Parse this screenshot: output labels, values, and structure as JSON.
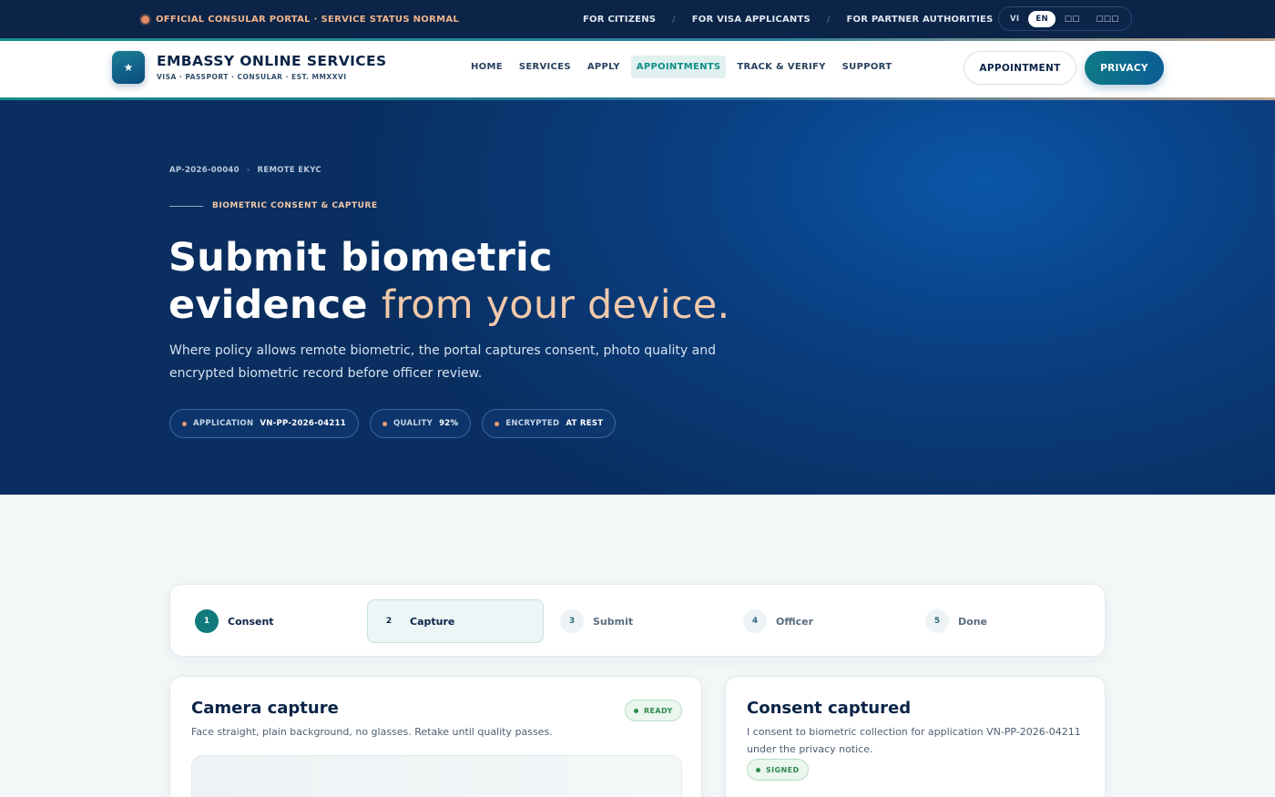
{
  "topbar": {
    "status": "OFFICIAL CONSULAR PORTAL · SERVICE STATUS NORMAL",
    "audiences": [
      "FOR CITIZENS",
      "FOR VISA APPLICANTS",
      "FOR PARTNER AUTHORITIES"
    ],
    "separator": "/",
    "languages": [
      "VI",
      "EN",
      "□□",
      "□□□"
    ],
    "active_language": "EN"
  },
  "header": {
    "logo_glyph": "★",
    "brand_title": "EMBASSY ONLINE SERVICES",
    "brand_subtitle": "VISA · PASSPORT · CONSULAR · EST. MMXXVI",
    "nav": [
      "HOME",
      "SERVICES",
      "APPLY",
      "APPOINTMENTS",
      "TRACK & VERIFY",
      "SUPPORT"
    ],
    "active_nav": "APPOINTMENTS",
    "btn_appointment": "APPOINTMENT",
    "btn_privacy": "PRIVACY"
  },
  "hero": {
    "breadcrumb": [
      "AP-2026-00040",
      "REMOTE EKYC"
    ],
    "breadcrumb_sep": "›",
    "eyebrow": "BIOMETRIC CONSENT & CAPTURE",
    "title_line1": "Submit biometric",
    "title_line2_a": "evidence",
    "title_line2_b": "from your device.",
    "description": "Where policy allows remote biometric, the portal captures consent, photo quality and encrypted biometric record before officer review.",
    "chips": [
      {
        "key": "APPLICATION",
        "value": "VN-PP-2026-04211"
      },
      {
        "key": "QUALITY",
        "value": "92%"
      },
      {
        "key": "ENCRYPTED",
        "value": "AT REST"
      }
    ]
  },
  "stepper": {
    "steps": [
      {
        "num": "1",
        "label": "Consent",
        "state": "done"
      },
      {
        "num": "2",
        "label": "Capture",
        "state": "current"
      },
      {
        "num": "3",
        "label": "Submit",
        "state": "todo"
      },
      {
        "num": "4",
        "label": "Officer",
        "state": "todo"
      },
      {
        "num": "5",
        "label": "Done",
        "state": "todo"
      }
    ]
  },
  "camera_card": {
    "title": "Camera capture",
    "subtitle": "Face straight, plain background, no glasses. Retake until quality passes.",
    "badge": "READY"
  },
  "consent_card": {
    "title": "Consent captured",
    "text": "I consent to biometric collection for application VN-PP-2026-04211 under the privacy notice.",
    "badge": "SIGNED"
  },
  "colors": {
    "navy": "#0b2447",
    "teal": "#127a7d",
    "accent_peach": "#f1c9ab",
    "status_green": "#2f8a4f"
  }
}
